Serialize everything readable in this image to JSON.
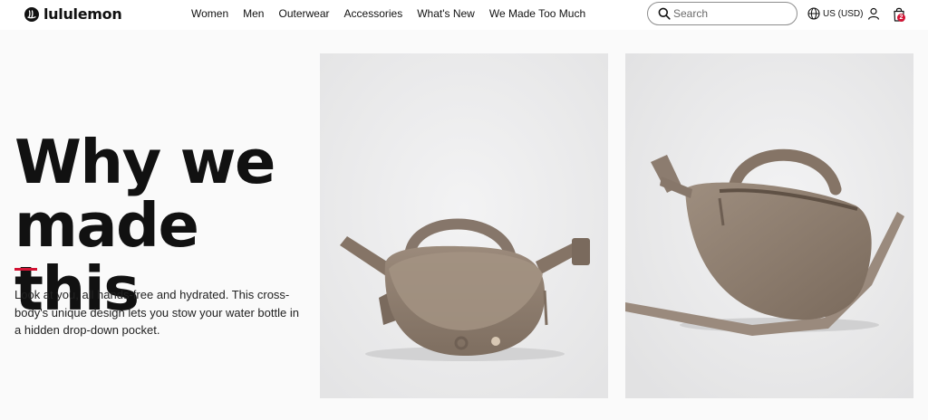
{
  "header": {
    "brand": "lululemon",
    "nav": [
      "Women",
      "Men",
      "Outerwear",
      "Accessories",
      "What's New",
      "We Made Too Much"
    ],
    "search_placeholder": "Search",
    "locale": "US (USD)",
    "bag_count": "2"
  },
  "hero": {
    "headline_line1": "Why we",
    "headline_line2": "made this",
    "accent_color": "#d31334",
    "body_line1": "Look at you, all hands-free and hydrated. This cross-",
    "body_line2": "body's unique design lets you stow your water bottle in",
    "body_line3": "a hidden drop-down pocket."
  },
  "images": {
    "left": "belt-bag-front-view",
    "right": "belt-bag-back-angle-view"
  },
  "icons": {
    "logo": "lululemon-logo-mark",
    "search": "search-icon",
    "globe": "globe-icon",
    "account": "user-icon",
    "bag": "shopping-bag-icon"
  }
}
